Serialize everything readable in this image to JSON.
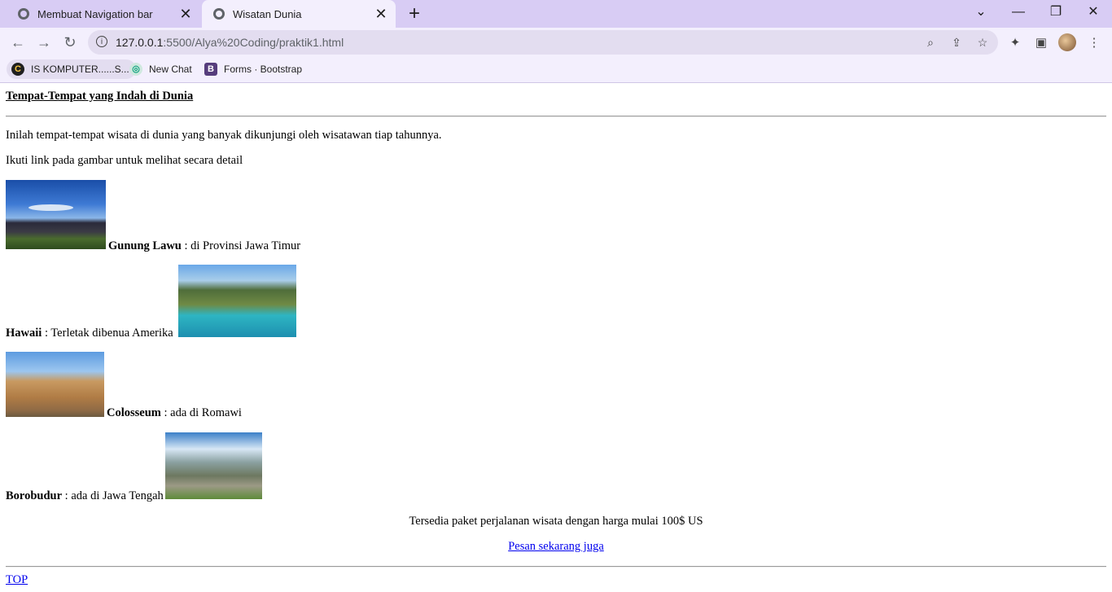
{
  "browser": {
    "tabs": [
      {
        "title": "Membuat Navigation bar",
        "active": false
      },
      {
        "title": "Wisatan Dunia",
        "active": true
      }
    ],
    "url_host": "127.0.0.1",
    "url_path": ":5500/Alya%20Coding/praktik1.html",
    "bookmarks": [
      {
        "label": "IS KOMPUTER......S...",
        "icon": "site-logo-icon"
      },
      {
        "label": "New Chat",
        "icon": "chatgpt-icon"
      },
      {
        "label": "Forms · Bootstrap",
        "icon": "bootstrap-icon"
      }
    ],
    "colors": {
      "frame": "#d8ccf4",
      "toolbar": "#f3effd",
      "link": "#0000ee"
    }
  },
  "page": {
    "heading": "Tempat-Tempat yang Indah di Dunia",
    "intro": "Inilah tempat-tempat wisata di dunia yang banyak dikunjungi oleh wisatawan tiap tahunnya.",
    "instruction": "Ikuti link pada gambar untuk melihat secara detail",
    "places": [
      {
        "name": "Gunung Lawu",
        "desc": " : di Provinsi Jawa Timur",
        "image": "mountain-photo"
      },
      {
        "name": "Hawaii",
        "desc": " : Terletak dibenua Amerika",
        "image": "hawaii-coast-photo"
      },
      {
        "name": "Colosseum",
        "desc": " : ada di Romawi",
        "image": "colosseum-photo"
      },
      {
        "name": "Borobudur",
        "desc": " : ada di Jawa Tengah",
        "image": "borobudur-photo"
      }
    ],
    "offer": "Tersedia paket perjalanan wisata dengan harga mulai 100$ US",
    "order_link": "Pesan sekarang juga",
    "top_link": "TOP"
  }
}
